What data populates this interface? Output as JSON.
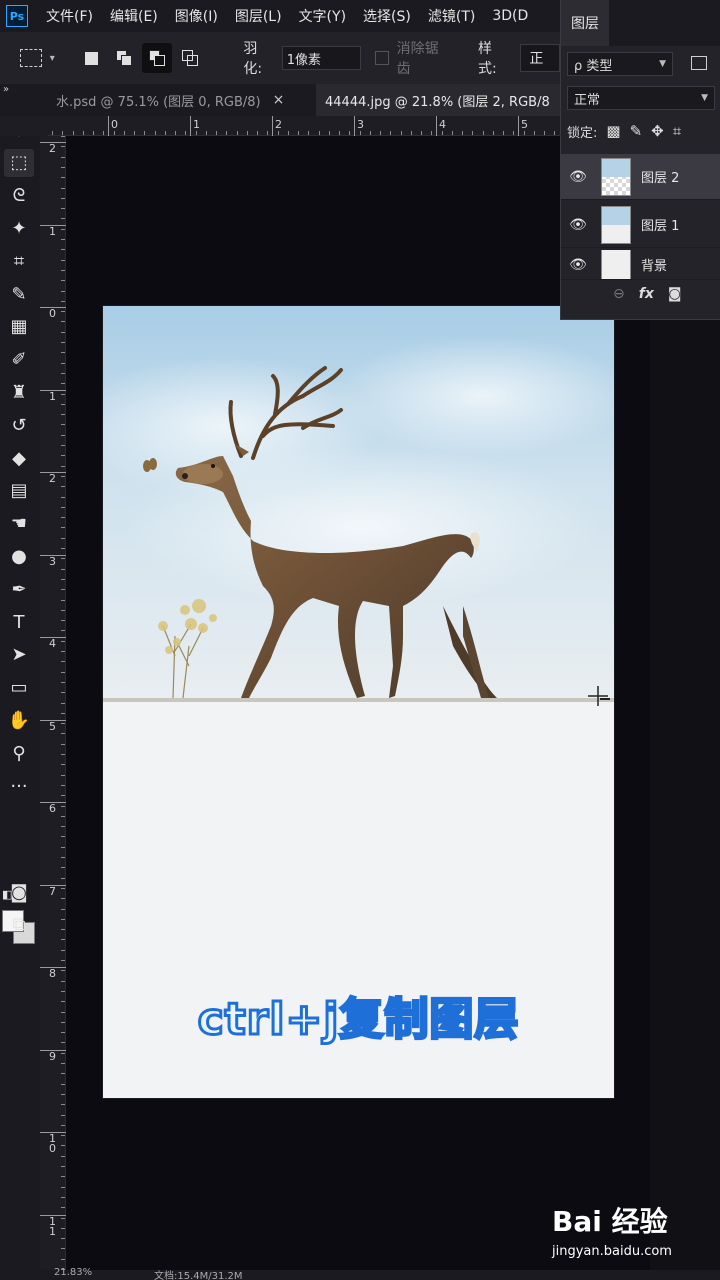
{
  "app": {
    "logo_text": "Ps"
  },
  "menu": [
    "文件(F)",
    "编辑(E)",
    "图像(I)",
    "图层(L)",
    "文字(Y)",
    "选择(S)",
    "滤镜(T)",
    "3D(D"
  ],
  "options_bar": {
    "feather_label": "羽化:",
    "feather_value": "1像素",
    "anti_alias_label": "消除锯齿",
    "style_label": "样式:",
    "style_value": "正"
  },
  "tabs": [
    {
      "label": "水.psd @ 75.1% (图层 0, RGB/8)",
      "close": "×"
    },
    {
      "label": "44444.jpg @ 21.8% (图层 2, RGB/8"
    }
  ],
  "ruler": {
    "h_labels": [
      "0",
      "1",
      "2",
      "3",
      "4",
      "5"
    ],
    "v_labels": [
      "2",
      "1",
      "0",
      "1",
      "2",
      "3",
      "4",
      "5",
      "6",
      "7",
      "8",
      "9",
      "1 0",
      "1 1"
    ]
  },
  "tools": [
    {
      "name": "move-tool",
      "glyph": "✥"
    },
    {
      "name": "marquee-tool",
      "glyph": "⬚"
    },
    {
      "name": "lasso-tool",
      "glyph": "ᘓ"
    },
    {
      "name": "magic-wand-tool",
      "glyph": "✦"
    },
    {
      "name": "crop-tool",
      "glyph": "⌗"
    },
    {
      "name": "eyedropper-tool",
      "glyph": "✎"
    },
    {
      "name": "healing-brush-tool",
      "glyph": "▦"
    },
    {
      "name": "brush-tool",
      "glyph": "✐"
    },
    {
      "name": "clone-stamp-tool",
      "glyph": "♜"
    },
    {
      "name": "history-brush-tool",
      "glyph": "↺"
    },
    {
      "name": "eraser-tool",
      "glyph": "◆"
    },
    {
      "name": "gradient-tool",
      "glyph": "▤"
    },
    {
      "name": "smudge-tool",
      "glyph": "☚"
    },
    {
      "name": "dodge-tool",
      "glyph": "●"
    },
    {
      "name": "pen-tool",
      "glyph": "✒"
    },
    {
      "name": "type-tool",
      "glyph": "T"
    },
    {
      "name": "path-selection-tool",
      "glyph": "➤"
    },
    {
      "name": "rectangle-tool",
      "glyph": "▭"
    },
    {
      "name": "hand-tool",
      "glyph": "✋"
    },
    {
      "name": "zoom-tool",
      "glyph": "⚲"
    },
    {
      "name": "more-tools",
      "glyph": "···"
    }
  ],
  "canvas": {
    "caption": "ctrl+j复制图层",
    "caption_colors": {
      "fill": "#e9f6ff",
      "stroke": "#1f6fd8"
    }
  },
  "layers_panel": {
    "tab_label": "图层",
    "filter_label": "ρ 类型",
    "blend_mode": "正常",
    "lock_label": "锁定:",
    "layers": [
      {
        "name": "图层 2",
        "selected": true
      },
      {
        "name": "图层 1",
        "selected": false
      },
      {
        "name": "背景",
        "selected": false
      }
    ],
    "footer": {
      "link": "⊖",
      "fx": "fx",
      "mask": "◙"
    }
  },
  "status": {
    "zoom": "21.83%",
    "doc": "文档:15.4M/31.2M"
  },
  "watermark": {
    "logo": "Bai 经验",
    "url": "jingyan.baidu.com"
  }
}
